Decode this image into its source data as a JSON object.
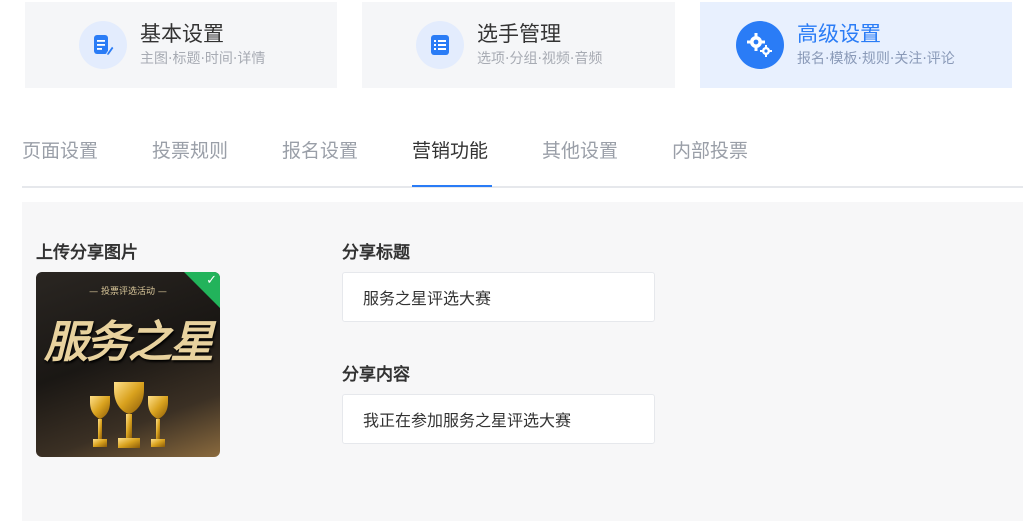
{
  "steps": [
    {
      "title": "基本设置",
      "subtitle": "主图·标题·时间·详情",
      "icon": "edit-doc-icon"
    },
    {
      "title": "选手管理",
      "subtitle": "选项·分组·视频·音频",
      "icon": "list-icon"
    },
    {
      "title": "高级设置",
      "subtitle": "报名·模板·规则·关注·评论",
      "icon": "gears-icon"
    }
  ],
  "tabs": [
    "页面设置",
    "投票规则",
    "报名设置",
    "营销功能",
    "其他设置",
    "内部投票"
  ],
  "active_tab": "营销功能",
  "form": {
    "upload_label": "上传分享图片",
    "image": {
      "tagline": "— 投票评选活动 —",
      "title": "服务之星"
    },
    "share_title_label": "分享标题",
    "share_title_value": "服务之星评选大赛",
    "share_content_label": "分享内容",
    "share_content_value": "我正在参加服务之星评选大赛"
  },
  "colors": {
    "accent": "#2a7cf6",
    "check_badge": "#22b35b"
  }
}
